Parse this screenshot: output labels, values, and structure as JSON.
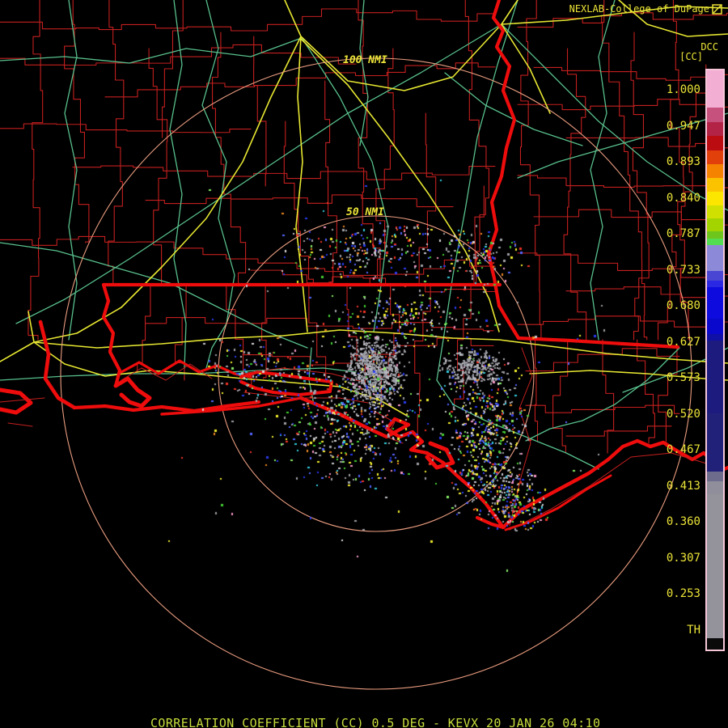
{
  "header": {
    "brand": "NEXLAB-College of DuPage",
    "logo_icon": "box-diagonal-icon",
    "product_id": "DCC",
    "product_bracket": "[CC]"
  },
  "range_rings": {
    "outer_label": "100 NMI",
    "inner_label": "50 NMI"
  },
  "colorbar": {
    "labels": [
      "1.000",
      "0.947",
      "0.893",
      "0.840",
      "0.787",
      "0.733",
      "0.680",
      "0.627",
      "0.573",
      "0.520",
      "0.467",
      "0.413",
      "0.360",
      "0.307",
      "0.253",
      "TH"
    ],
    "outline_color": "#f6c6d8",
    "segments": [
      {
        "c": "#f3aed3",
        "h": 46
      },
      {
        "c": "#c7517d",
        "h": 18
      },
      {
        "c": "#b22346",
        "h": 17
      },
      {
        "c": "#bb0d11",
        "h": 18
      },
      {
        "c": "#e2400b",
        "h": 17
      },
      {
        "c": "#f68300",
        "h": 17
      },
      {
        "c": "#fbc200",
        "h": 17
      },
      {
        "c": "#fce600",
        "h": 17
      },
      {
        "c": "#d0e000",
        "h": 16
      },
      {
        "c": "#a4d400",
        "h": 16
      },
      {
        "c": "#6ec61c",
        "h": 9
      },
      {
        "c": "#52dd52",
        "h": 8
      },
      {
        "c": "#8c8ad8",
        "h": 32
      },
      {
        "c": "#4846d2",
        "h": 12
      },
      {
        "c": "#2a28e2",
        "h": 8
      },
      {
        "c": "#0d0bdd",
        "h": 39
      },
      {
        "c": "#0a08cc",
        "h": 19
      },
      {
        "c": "#100fa6",
        "h": 8
      },
      {
        "c": "#1d1c7e",
        "h": 90
      },
      {
        "c": "#22217a",
        "h": 72
      },
      {
        "c": "#6d6c8c",
        "h": 12
      },
      {
        "c": "#8f8e9a",
        "h": 16
      },
      {
        "c": "#94939c",
        "h": 178
      },
      {
        "c": "#0a0a0a",
        "h": 14
      }
    ]
  },
  "caption": "CORRELATION COEFFICIENT (CC) 0.5 DEG - KEVX 20 JAN 26 04:10",
  "colors": {
    "background": "#000000",
    "county_lines": "#c41f1f",
    "state_lines": "#ee0c0c",
    "roads_primary": "#e6e632",
    "roads_secondary": "#58c08c",
    "range_ring": "#eb9d80",
    "labels": "#ece438",
    "caption": "#c8dc3c"
  }
}
